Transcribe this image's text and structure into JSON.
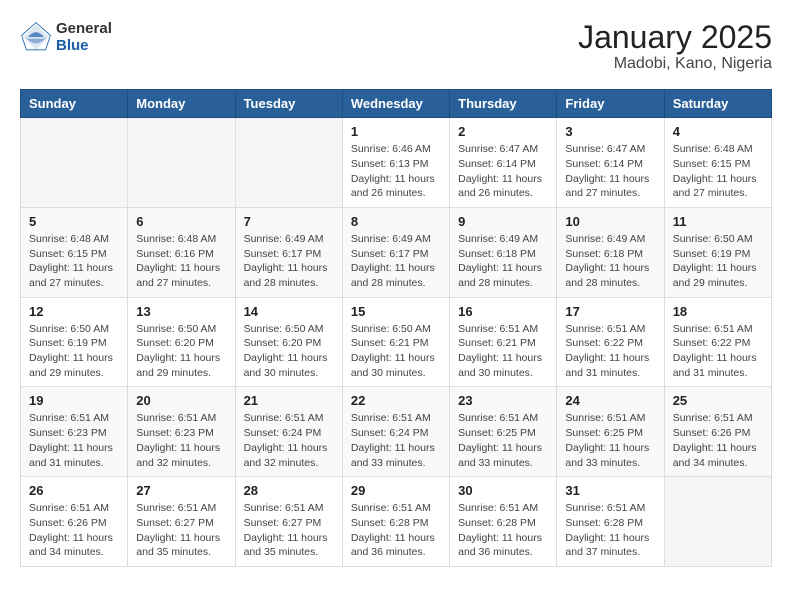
{
  "header": {
    "logo_general": "General",
    "logo_blue": "Blue",
    "title": "January 2025",
    "subtitle": "Madobi, Kano, Nigeria"
  },
  "days_of_week": [
    "Sunday",
    "Monday",
    "Tuesday",
    "Wednesday",
    "Thursday",
    "Friday",
    "Saturday"
  ],
  "weeks": [
    [
      {
        "day": "",
        "info": ""
      },
      {
        "day": "",
        "info": ""
      },
      {
        "day": "",
        "info": ""
      },
      {
        "day": "1",
        "info": "Sunrise: 6:46 AM\nSunset: 6:13 PM\nDaylight: 11 hours\nand 26 minutes."
      },
      {
        "day": "2",
        "info": "Sunrise: 6:47 AM\nSunset: 6:14 PM\nDaylight: 11 hours\nand 26 minutes."
      },
      {
        "day": "3",
        "info": "Sunrise: 6:47 AM\nSunset: 6:14 PM\nDaylight: 11 hours\nand 27 minutes."
      },
      {
        "day": "4",
        "info": "Sunrise: 6:48 AM\nSunset: 6:15 PM\nDaylight: 11 hours\nand 27 minutes."
      }
    ],
    [
      {
        "day": "5",
        "info": "Sunrise: 6:48 AM\nSunset: 6:15 PM\nDaylight: 11 hours\nand 27 minutes."
      },
      {
        "day": "6",
        "info": "Sunrise: 6:48 AM\nSunset: 6:16 PM\nDaylight: 11 hours\nand 27 minutes."
      },
      {
        "day": "7",
        "info": "Sunrise: 6:49 AM\nSunset: 6:17 PM\nDaylight: 11 hours\nand 28 minutes."
      },
      {
        "day": "8",
        "info": "Sunrise: 6:49 AM\nSunset: 6:17 PM\nDaylight: 11 hours\nand 28 minutes."
      },
      {
        "day": "9",
        "info": "Sunrise: 6:49 AM\nSunset: 6:18 PM\nDaylight: 11 hours\nand 28 minutes."
      },
      {
        "day": "10",
        "info": "Sunrise: 6:49 AM\nSunset: 6:18 PM\nDaylight: 11 hours\nand 28 minutes."
      },
      {
        "day": "11",
        "info": "Sunrise: 6:50 AM\nSunset: 6:19 PM\nDaylight: 11 hours\nand 29 minutes."
      }
    ],
    [
      {
        "day": "12",
        "info": "Sunrise: 6:50 AM\nSunset: 6:19 PM\nDaylight: 11 hours\nand 29 minutes."
      },
      {
        "day": "13",
        "info": "Sunrise: 6:50 AM\nSunset: 6:20 PM\nDaylight: 11 hours\nand 29 minutes."
      },
      {
        "day": "14",
        "info": "Sunrise: 6:50 AM\nSunset: 6:20 PM\nDaylight: 11 hours\nand 30 minutes."
      },
      {
        "day": "15",
        "info": "Sunrise: 6:50 AM\nSunset: 6:21 PM\nDaylight: 11 hours\nand 30 minutes."
      },
      {
        "day": "16",
        "info": "Sunrise: 6:51 AM\nSunset: 6:21 PM\nDaylight: 11 hours\nand 30 minutes."
      },
      {
        "day": "17",
        "info": "Sunrise: 6:51 AM\nSunset: 6:22 PM\nDaylight: 11 hours\nand 31 minutes."
      },
      {
        "day": "18",
        "info": "Sunrise: 6:51 AM\nSunset: 6:22 PM\nDaylight: 11 hours\nand 31 minutes."
      }
    ],
    [
      {
        "day": "19",
        "info": "Sunrise: 6:51 AM\nSunset: 6:23 PM\nDaylight: 11 hours\nand 31 minutes."
      },
      {
        "day": "20",
        "info": "Sunrise: 6:51 AM\nSunset: 6:23 PM\nDaylight: 11 hours\nand 32 minutes."
      },
      {
        "day": "21",
        "info": "Sunrise: 6:51 AM\nSunset: 6:24 PM\nDaylight: 11 hours\nand 32 minutes."
      },
      {
        "day": "22",
        "info": "Sunrise: 6:51 AM\nSunset: 6:24 PM\nDaylight: 11 hours\nand 33 minutes."
      },
      {
        "day": "23",
        "info": "Sunrise: 6:51 AM\nSunset: 6:25 PM\nDaylight: 11 hours\nand 33 minutes."
      },
      {
        "day": "24",
        "info": "Sunrise: 6:51 AM\nSunset: 6:25 PM\nDaylight: 11 hours\nand 33 minutes."
      },
      {
        "day": "25",
        "info": "Sunrise: 6:51 AM\nSunset: 6:26 PM\nDaylight: 11 hours\nand 34 minutes."
      }
    ],
    [
      {
        "day": "26",
        "info": "Sunrise: 6:51 AM\nSunset: 6:26 PM\nDaylight: 11 hours\nand 34 minutes."
      },
      {
        "day": "27",
        "info": "Sunrise: 6:51 AM\nSunset: 6:27 PM\nDaylight: 11 hours\nand 35 minutes."
      },
      {
        "day": "28",
        "info": "Sunrise: 6:51 AM\nSunset: 6:27 PM\nDaylight: 11 hours\nand 35 minutes."
      },
      {
        "day": "29",
        "info": "Sunrise: 6:51 AM\nSunset: 6:28 PM\nDaylight: 11 hours\nand 36 minutes."
      },
      {
        "day": "30",
        "info": "Sunrise: 6:51 AM\nSunset: 6:28 PM\nDaylight: 11 hours\nand 36 minutes."
      },
      {
        "day": "31",
        "info": "Sunrise: 6:51 AM\nSunset: 6:28 PM\nDaylight: 11 hours\nand 37 minutes."
      },
      {
        "day": "",
        "info": ""
      }
    ]
  ]
}
